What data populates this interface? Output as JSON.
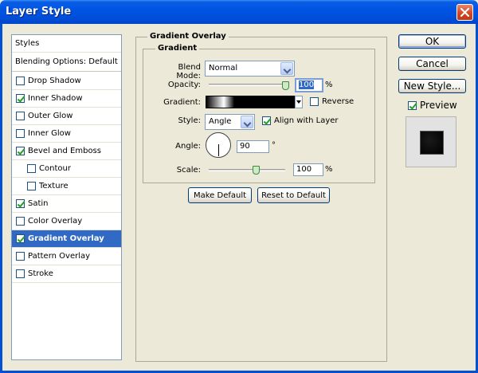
{
  "window": {
    "title": "Layer Style"
  },
  "styles_list": {
    "header": "Styles",
    "blending": "Blending Options: Default",
    "items": [
      {
        "label": "Drop Shadow",
        "checked": false,
        "indent": false
      },
      {
        "label": "Inner Shadow",
        "checked": true,
        "indent": false
      },
      {
        "label": "Outer Glow",
        "checked": false,
        "indent": false
      },
      {
        "label": "Inner Glow",
        "checked": false,
        "indent": false
      },
      {
        "label": "Bevel and Emboss",
        "checked": true,
        "indent": false
      },
      {
        "label": "Contour",
        "checked": false,
        "indent": true
      },
      {
        "label": "Texture",
        "checked": false,
        "indent": true
      },
      {
        "label": "Satin",
        "checked": true,
        "indent": false
      },
      {
        "label": "Color Overlay",
        "checked": false,
        "indent": false
      },
      {
        "label": "Gradient Overlay",
        "checked": true,
        "indent": false,
        "selected": true
      },
      {
        "label": "Pattern Overlay",
        "checked": false,
        "indent": false
      },
      {
        "label": "Stroke",
        "checked": false,
        "indent": false
      }
    ]
  },
  "panel": {
    "group_title": "Gradient Overlay",
    "sub_title": "Gradient",
    "blend_mode_label": "Blend Mode:",
    "blend_mode_value": "Normal",
    "opacity_label": "Opacity:",
    "opacity_value": "100",
    "opacity_unit": "%",
    "gradient_label": "Gradient:",
    "reverse_label": "Reverse",
    "reverse_checked": false,
    "style_label": "Style:",
    "style_value": "Angle",
    "align_label": "Align with Layer",
    "align_checked": true,
    "angle_label": "Angle:",
    "angle_value": "90",
    "angle_unit": "°",
    "scale_label": "Scale:",
    "scale_value": "100",
    "scale_unit": "%",
    "make_default": "Make Default",
    "reset_default": "Reset to Default"
  },
  "actions": {
    "ok": "OK",
    "cancel": "Cancel",
    "new_style": "New Style...",
    "preview_label": "Preview",
    "preview_checked": true
  },
  "colors": {
    "title_bar": "#0054e3",
    "selection": "#316ac5"
  }
}
